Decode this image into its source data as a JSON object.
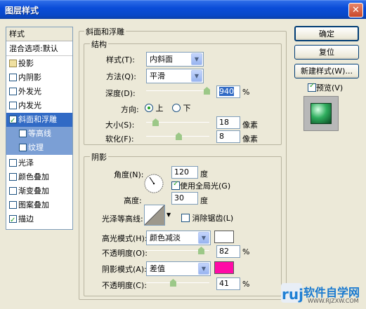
{
  "window": {
    "title": "图层样式",
    "close_glyph": "✕"
  },
  "styles_list": {
    "header": "样式",
    "blend_options": "混合选项:默认",
    "items": [
      {
        "label": "投影",
        "checked": false
      },
      {
        "label": "内阴影",
        "checked": false
      },
      {
        "label": "外发光",
        "checked": false
      },
      {
        "label": "内发光",
        "checked": false
      },
      {
        "label": "斜面和浮雕",
        "checked": true
      },
      {
        "label": "等高线",
        "checked": false
      },
      {
        "label": "纹理",
        "checked": false
      },
      {
        "label": "光泽",
        "checked": false
      },
      {
        "label": "颜色叠加",
        "checked": false
      },
      {
        "label": "渐变叠加",
        "checked": false
      },
      {
        "label": "图案叠加",
        "checked": false
      },
      {
        "label": "描边",
        "checked": true
      }
    ]
  },
  "bevel": {
    "section_title": "斜面和浮雕",
    "structure": {
      "title": "结构",
      "style_label": "样式(T):",
      "style_value": "内斜面",
      "technique_label": "方法(Q):",
      "technique_value": "平滑",
      "depth_label": "深度(D):",
      "depth_value": "940",
      "depth_unit": "%",
      "direction_label": "方向:",
      "direction_up": "上",
      "direction_down": "下",
      "direction_selected": "上",
      "size_label": "大小(S):",
      "size_value": "18",
      "size_unit": "像素",
      "soften_label": "软化(F):",
      "soften_value": "8",
      "soften_unit": "像素"
    },
    "shading": {
      "title": "阴影",
      "angle_label": "角度(N):",
      "angle_value": "120",
      "angle_unit": "度",
      "global_light_label": "使用全局光(G)",
      "global_light_checked": true,
      "altitude_label": "高度:",
      "altitude_value": "30",
      "altitude_unit": "度",
      "gloss_contour_label": "光泽等高线:",
      "anti_alias_label": "消除锯齿(L)",
      "anti_alias_checked": false,
      "highlight_mode_label": "高光模式(H):",
      "highlight_mode_value": "颜色减淡",
      "highlight_color": "#ffffff",
      "highlight_opacity_label": "不透明度(O):",
      "highlight_opacity_value": "82",
      "highlight_opacity_unit": "%",
      "shadow_mode_label": "阴影模式(A):",
      "shadow_mode_value": "差值",
      "shadow_color": "#ff0aa6",
      "shadow_opacity_label": "不透明度(C):",
      "shadow_opacity_value": "41",
      "shadow_opacity_unit": "%"
    }
  },
  "buttons": {
    "ok": "确定",
    "reset": "复位",
    "new_style": "新建样式(W)...",
    "preview_label": "预览(V)",
    "preview_checked": true
  },
  "watermark": {
    "logo_letters": "ruj",
    "site_name": "软件自学网",
    "url": "WWW.RJZXW.COM"
  }
}
